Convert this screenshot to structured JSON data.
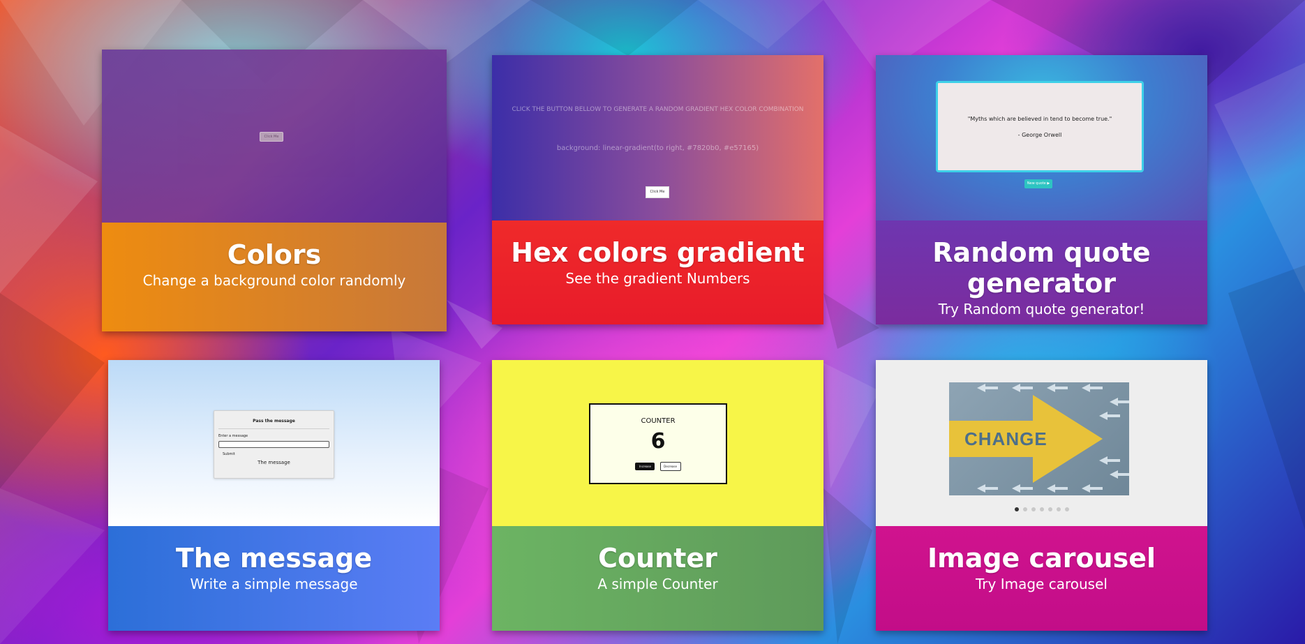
{
  "cards": [
    {
      "title": "Colors",
      "subtitle": "Change a background color randomly",
      "preview": {
        "button_label": "Click Me"
      }
    },
    {
      "title": "Hex colors gradient",
      "subtitle": "See the gradient Numbers",
      "preview": {
        "heading": "CLICK THE BUTTON BELLOW TO GENERATE A RANDOM GRADIENT HEX COLOR COMBINATION",
        "code": "background: linear-gradient(to right, #7820b0, #e57165)",
        "button_label": "Click Me"
      }
    },
    {
      "title": "Random quote generator",
      "subtitle": "Try Random quote generator!",
      "preview": {
        "quote": "\"Myths which are believed in tend to become true.\"",
        "author": "- George Orwell",
        "button_label": "New quote ▶"
      }
    },
    {
      "title": "The message",
      "subtitle": "Write a simple message",
      "preview": {
        "heading": "Pass the message",
        "label": "Enter a message",
        "submit_label": "Submit",
        "output": "The message"
      }
    },
    {
      "title": "Counter",
      "subtitle": "A simple Counter",
      "preview": {
        "heading": "COUNTER",
        "value": "6",
        "increase_label": "Increase",
        "decrease_label": "Decrease"
      }
    },
    {
      "title": "Image carousel",
      "subtitle": "Try Image carousel",
      "preview": {
        "image_word": "CHANGE",
        "dot_count": 7,
        "active_dot": 1
      }
    }
  ]
}
